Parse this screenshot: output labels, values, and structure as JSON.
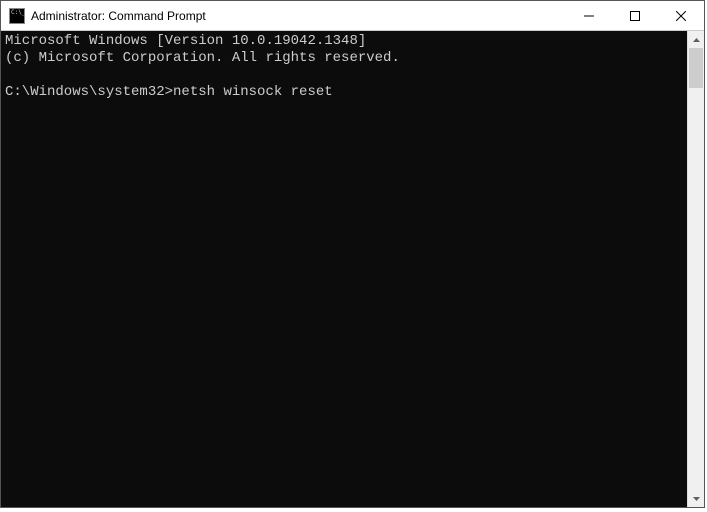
{
  "window": {
    "title": "Administrator: Command Prompt"
  },
  "console": {
    "line1": "Microsoft Windows [Version 10.0.19042.1348]",
    "line2": "(c) Microsoft Corporation. All rights reserved.",
    "blank": "",
    "prompt": "C:\\Windows\\system32>",
    "command": "netsh winsock reset"
  }
}
